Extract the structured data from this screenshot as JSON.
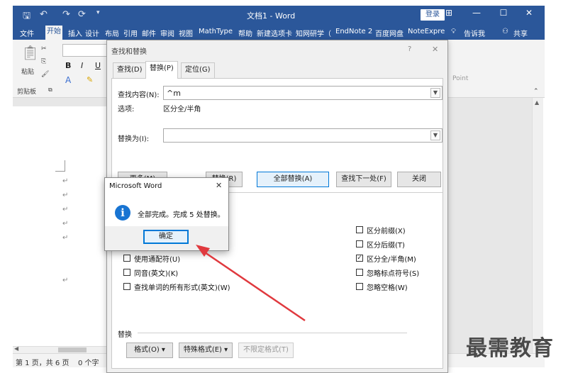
{
  "title_bar": {
    "doc_title": "文档1 - Word",
    "login_label": "登录",
    "restore_glyph": "⊞",
    "minimize_glyph": "—",
    "maximize_glyph": "☐",
    "close_glyph": "✕"
  },
  "ribbon_tabs": [
    "文件",
    "开始",
    "插入",
    "设计",
    "布局",
    "引用",
    "邮件",
    "审阅",
    "视图",
    "MathType",
    "帮助",
    "新建选项卡",
    "知网研学（",
    "EndNote 2",
    "百度网盘",
    "NoteExpre"
  ],
  "ribbon_right": {
    "tell_me": "告诉我",
    "share": "共享"
  },
  "ribbon": {
    "paste_label": "粘贴",
    "clipboard_label": "剪贴板",
    "bold": "B",
    "italic": "I",
    "underline": "U",
    "style_hint": "Point"
  },
  "find_replace": {
    "title": "查找和替换",
    "help": "?",
    "close": "✕",
    "tabs": [
      "查找(D)",
      "替换(P)",
      "定位(G)"
    ],
    "find_label": "查找内容(N):",
    "find_value": "^m",
    "options_label": "选项:",
    "options_value": "区分全/半角",
    "replace_label": "替换为(I):",
    "replace_value": "",
    "btn_more": "更多(M)",
    "btn_replace": "替换(R)",
    "btn_replace_all": "全部替换(A)",
    "btn_find_next": "查找下一处(F)",
    "btn_close": "关闭",
    "checkboxes_left": [
      {
        "label": "使用通配符(U)",
        "checked": false
      },
      {
        "label": "同音(英文)(K)",
        "checked": false
      },
      {
        "label": "查找单词的所有形式(英文)(W)",
        "checked": false
      }
    ],
    "checkboxes_right": [
      {
        "label": "区分前缀(X)",
        "checked": false
      },
      {
        "label": "区分后缀(T)",
        "checked": false
      },
      {
        "label": "区分全/半角(M)",
        "checked": true
      },
      {
        "label": "忽略标点符号(S)",
        "checked": false
      },
      {
        "label": "忽略空格(W)",
        "checked": false
      }
    ],
    "replace_section": "替换",
    "btn_format": "格式(O) ▾",
    "btn_special": "特殊格式(E) ▾",
    "btn_no_format": "不限定格式(T)"
  },
  "message_box": {
    "title": "Microsoft Word",
    "close": "✕",
    "icon": "info-icon",
    "message": "全部完成。完成 5 处替换。",
    "ok_label": "确定"
  },
  "status_bar": {
    "page": "第 1 页，共 6 页",
    "words": "0 个字"
  },
  "paragraph_mark": "↵",
  "watermark": "最需教育",
  "colors": {
    "word_blue": "#2b579a",
    "accent": "#0078d7",
    "arrow_red": "#e0393e",
    "info_blue": "#1874d2"
  }
}
